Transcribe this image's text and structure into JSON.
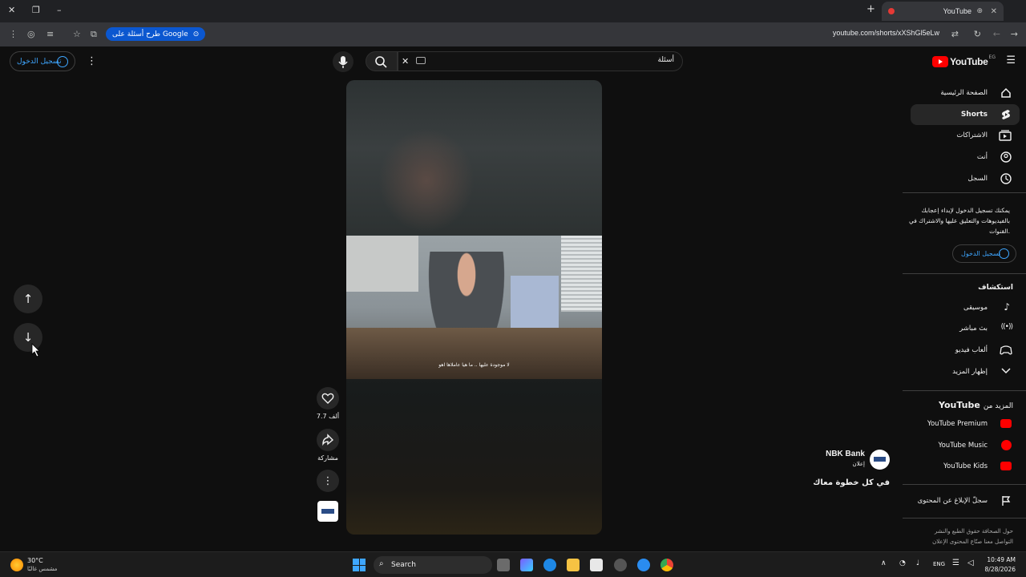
{
  "browser": {
    "tab_title": "YouTube",
    "url": "youtube.com/shorts/xXShGl5eLw",
    "google_pill": "طرح أسئلة على Google"
  },
  "youtube": {
    "logo": "YouTube",
    "logo_region": "EG",
    "search_query": "أسئلة",
    "sign_in": "تسجيل الدخول",
    "sidebar": {
      "items": [
        {
          "label": "الصفحة الرئيسية",
          "icon": "home-icon"
        },
        {
          "label": "Shorts",
          "icon": "shorts-icon",
          "active": true
        },
        {
          "label": "الاشتراكات",
          "icon": "subscriptions-icon"
        },
        {
          "label": "أنت",
          "icon": "you-icon"
        },
        {
          "label": "السجل",
          "icon": "history-icon"
        }
      ],
      "signin_prompt": "يمكنك تسجيل الدخول لإبداء إعجابك بالفيديوهات والتعليق عليها والاشتراك في القنوات.",
      "signin_button": "تسجيل الدخول",
      "explore_title": "استكشاف",
      "explore": [
        {
          "label": "موسيقى",
          "icon": "music-icon"
        },
        {
          "label": "بث مباشر",
          "icon": "live-icon"
        },
        {
          "label": "ألعاب فيديو",
          "icon": "gaming-icon"
        },
        {
          "label": "إظهار المزيد",
          "icon": "chevron-down-icon"
        }
      ],
      "more_title_prefix": "المزيد من",
      "more_title_brand": "YouTube",
      "more": [
        "YouTube Premium",
        "YouTube Music",
        "YouTube Kids"
      ],
      "report_history": "سجلّ الإبلاغ عن المحتوى",
      "footer_line1": "حول  الصحافة  حقوق الطبع والنشر",
      "footer_line2": "التواصل معنا  صنّاع المحتوى  الإعلان"
    },
    "short": {
      "subtitle": "لا موجودة عليها .. ما هيا عاملاها اهو",
      "likes": "7.7 ألف",
      "share": "مشاركة",
      "channel": "NBK Bank",
      "sponsored": "إعلان",
      "caption": "في كل خطوة معاك"
    }
  },
  "taskbar": {
    "weather_temp": "30°C",
    "weather_desc": "مشمس غالبًا",
    "search": "Search",
    "lang": "ENG",
    "time": "10:49 AM",
    "date": "8/28/2026"
  }
}
